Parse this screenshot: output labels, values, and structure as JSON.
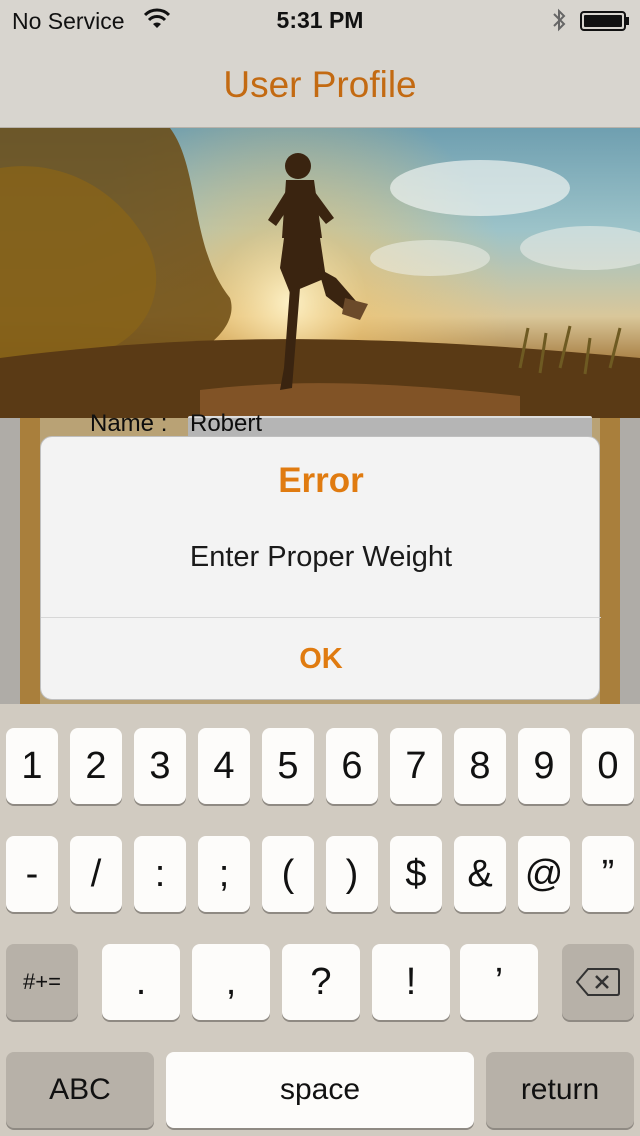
{
  "status_bar": {
    "carrier": "No Service",
    "time": "5:31 PM",
    "wifi_icon": "wifi-icon",
    "bluetooth_icon": "bluetooth-icon",
    "battery_icon": "battery-icon"
  },
  "nav": {
    "title": "User Profile"
  },
  "hero": {
    "image": "runner-photo"
  },
  "form": {
    "name_label": "Name :",
    "name_value": "Robert"
  },
  "alert": {
    "title": "Error",
    "message": "Enter Proper Weight",
    "ok_label": "OK",
    "accent_color": "#e07b10"
  },
  "keyboard": {
    "row1": [
      "1",
      "2",
      "3",
      "4",
      "5",
      "6",
      "7",
      "8",
      "9",
      "0"
    ],
    "row2": [
      "-",
      "/",
      ":",
      ";",
      "(",
      ")",
      "$",
      "&",
      "@",
      "”"
    ],
    "row3": [
      "#+=",
      ".",
      ",",
      "?",
      "!",
      "’"
    ],
    "backspace_icon": "backspace-icon",
    "abc_label": "ABC",
    "space_label": "space",
    "return_label": "return"
  }
}
